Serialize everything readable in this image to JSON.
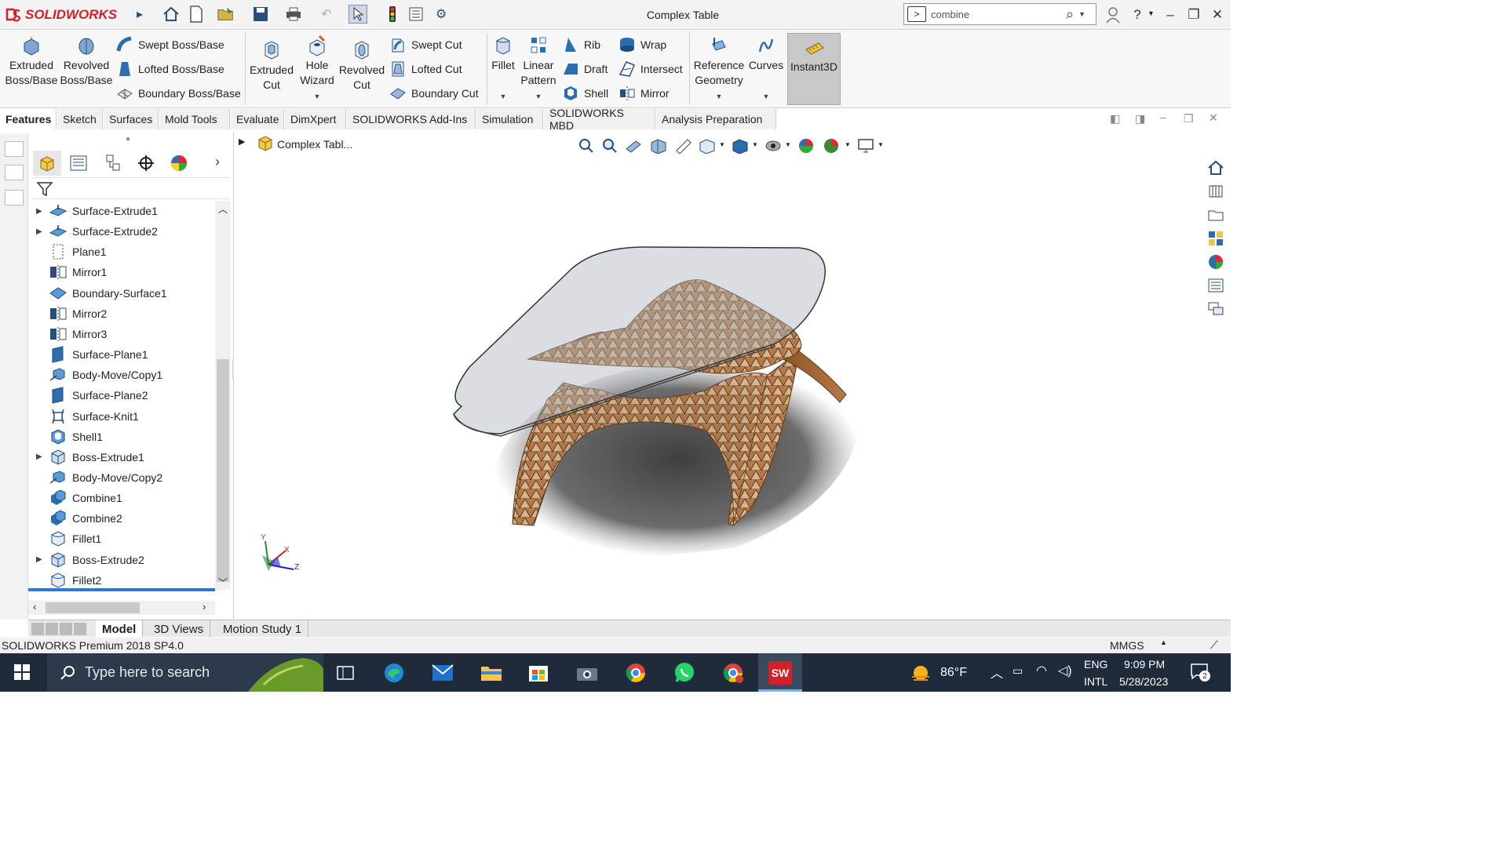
{
  "titlebar": {
    "logo_text": "SOLIDWORKS",
    "window_title": "Complex Table",
    "search": {
      "value": "combine"
    }
  },
  "ribbon": {
    "extruded_boss": "Extruded\nBoss/Base",
    "revolved_boss": "Revolved\nBoss/Base",
    "swept_boss": "Swept Boss/Base",
    "lofted_boss": "Lofted Boss/Base",
    "boundary_boss": "Boundary Boss/Base",
    "extruded_cut": "Extruded\nCut",
    "hole_wizard": "Hole\nWizard",
    "revolved_cut": "Revolved\nCut",
    "swept_cut": "Swept Cut",
    "lofted_cut": "Lofted Cut",
    "boundary_cut": "Boundary Cut",
    "fillet": "Fillet",
    "linear_pattern": "Linear\nPattern",
    "rib": "Rib",
    "draft": "Draft",
    "shell": "Shell",
    "wrap": "Wrap",
    "intersect": "Intersect",
    "mirror": "Mirror",
    "reference_geometry": "Reference\nGeometry",
    "curves": "Curves",
    "instant3d": "Instant3D"
  },
  "tabs": [
    "Features",
    "Sketch",
    "Surfaces",
    "Mold Tools",
    "Evaluate",
    "DimXpert",
    "SOLIDWORKS Add-Ins",
    "Simulation",
    "SOLIDWORKS MBD",
    "Analysis Preparation"
  ],
  "tree": {
    "items": [
      {
        "label": "Surface-Extrude1",
        "icon": "surface-extrude-icon",
        "expandable": true
      },
      {
        "label": "Surface-Extrude2",
        "icon": "surface-extrude-icon",
        "expandable": true
      },
      {
        "label": "Plane1",
        "icon": "plane-icon",
        "expandable": false
      },
      {
        "label": "Mirror1",
        "icon": "mirror-icon",
        "expandable": false
      },
      {
        "label": "Boundary-Surface1",
        "icon": "boundary-surface-icon",
        "expandable": false
      },
      {
        "label": "Mirror2",
        "icon": "mirror-icon",
        "expandable": false
      },
      {
        "label": "Mirror3",
        "icon": "mirror-icon",
        "expandable": false
      },
      {
        "label": "Surface-Plane1",
        "icon": "surface-plane-icon",
        "expandable": false
      },
      {
        "label": "Body-Move/Copy1",
        "icon": "body-move-icon",
        "expandable": false
      },
      {
        "label": "Surface-Plane2",
        "icon": "surface-plane-icon",
        "expandable": false
      },
      {
        "label": "Surface-Knit1",
        "icon": "surface-knit-icon",
        "expandable": false
      },
      {
        "label": "Shell1",
        "icon": "shell-icon",
        "expandable": false
      },
      {
        "label": "Boss-Extrude1",
        "icon": "boss-extrude-icon",
        "expandable": true
      },
      {
        "label": "Body-Move/Copy2",
        "icon": "body-move-icon",
        "expandable": false
      },
      {
        "label": "Combine1",
        "icon": "combine-icon",
        "expandable": false
      },
      {
        "label": "Combine2",
        "icon": "combine-icon",
        "expandable": false
      },
      {
        "label": "Fillet1",
        "icon": "fillet-icon",
        "expandable": false
      },
      {
        "label": "Boss-Extrude2",
        "icon": "boss-extrude-icon",
        "expandable": true
      },
      {
        "label": "Fillet2",
        "icon": "fillet-icon",
        "expandable": false
      }
    ]
  },
  "viewport": {
    "breadcrumb": "Complex Tabl...",
    "triad": {
      "y": "Y",
      "x": "X",
      "z": "Z"
    }
  },
  "bottom_tabs": [
    "Model",
    "3D Views",
    "Motion Study 1"
  ],
  "status": {
    "version": "SOLIDWORKS Premium 2018 SP4.0",
    "units": "MMGS"
  },
  "taskbar": {
    "search_placeholder": "Type here to search",
    "temperature": "86°F",
    "lang1": "ENG",
    "lang2": "INTL",
    "time": "9:09 PM",
    "date": "5/28/2023",
    "notif_count": "2",
    "sw_badge": "SW"
  },
  "colors": {
    "brand": "#d4202b",
    "wood": "#a0643a",
    "glass": "#b8bcc2"
  }
}
